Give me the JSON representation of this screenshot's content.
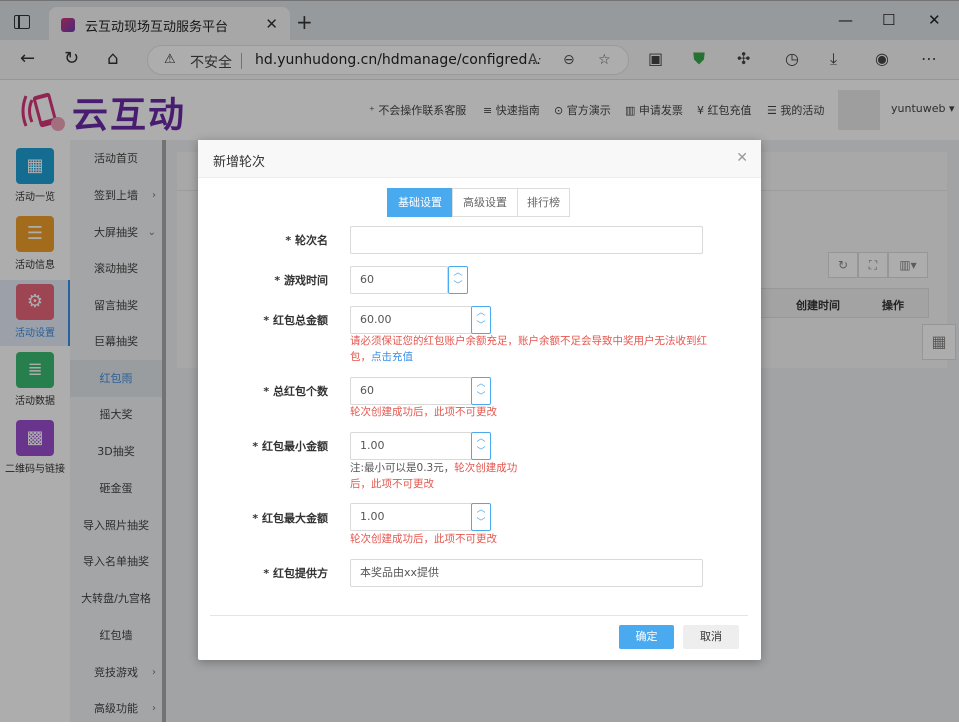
{
  "browser": {
    "tab_title": "云互动现场互动服务平台",
    "security_label": "不安全",
    "url": "hd.yunhudong.cn/hdmanage/configred..."
  },
  "header": {
    "logo_text": "云互动",
    "nav": [
      "不会操作联系客服",
      "快速指南",
      "官方演示",
      "申请发票",
      "红包充值",
      "我的活动"
    ],
    "username": "yuntuweb"
  },
  "sidebar": {
    "items": [
      {
        "label": "活动一览",
        "color": "#1f9fd6",
        "icon": "grid-icon"
      },
      {
        "label": "活动信息",
        "color": "#f0a02a",
        "icon": "document-icon"
      },
      {
        "label": "活动设置",
        "color": "#e8667a",
        "icon": "gear-icon"
      },
      {
        "label": "活动数据",
        "color": "#38bb71",
        "icon": "database-icon"
      },
      {
        "label": "二维码与链接",
        "color": "#9b4fcf",
        "icon": "qrcode-icon"
      }
    ]
  },
  "submenu": {
    "items": [
      "活动首页",
      "签到上墙",
      "大屏抽奖",
      "滚动抽奖",
      "留言抽奖",
      "巨幕抽奖",
      "红包雨",
      "摇大奖",
      "3D抽奖",
      "砸金蛋",
      "导入照片抽奖",
      "导入名单抽奖",
      "大转盘/九宫格",
      "红包墙",
      "竞技游戏",
      "高级功能"
    ]
  },
  "table_header": {
    "col_created": "创建时间",
    "col_action": "操作"
  },
  "dialog": {
    "title": "新增轮次",
    "tabs": [
      "基础设置",
      "高级设置",
      "排行榜"
    ],
    "fields": {
      "round_name": {
        "label": "* 轮次名",
        "value": ""
      },
      "game_time": {
        "label": "* 游戏时间",
        "value": "60"
      },
      "total_amount": {
        "label": "* 红包总金额",
        "value": "60.00",
        "hint_a": "请必须保证您的红包账户余额充足，账户余额不足会导致中奖用户无法收到红包，",
        "hint_link": "点击充值"
      },
      "total_count": {
        "label": "* 总红包个数",
        "value": "60",
        "hint": "轮次创建成功后，此项不可更改"
      },
      "min_amount": {
        "label": "* 红包最小金额",
        "value": "1.00",
        "hint_note": "注:最小可以是0.3元，",
        "hint_a": "轮次创建成功",
        "hint_b": "后，此项不可更改"
      },
      "max_amount": {
        "label": "* 红包最大金额",
        "value": "1.00",
        "hint": "轮次创建成功后，此项不可更改"
      },
      "provider": {
        "label": "* 红包提供方",
        "value": "本奖品由xx提供"
      }
    },
    "confirm": "确定",
    "cancel": "取消"
  }
}
